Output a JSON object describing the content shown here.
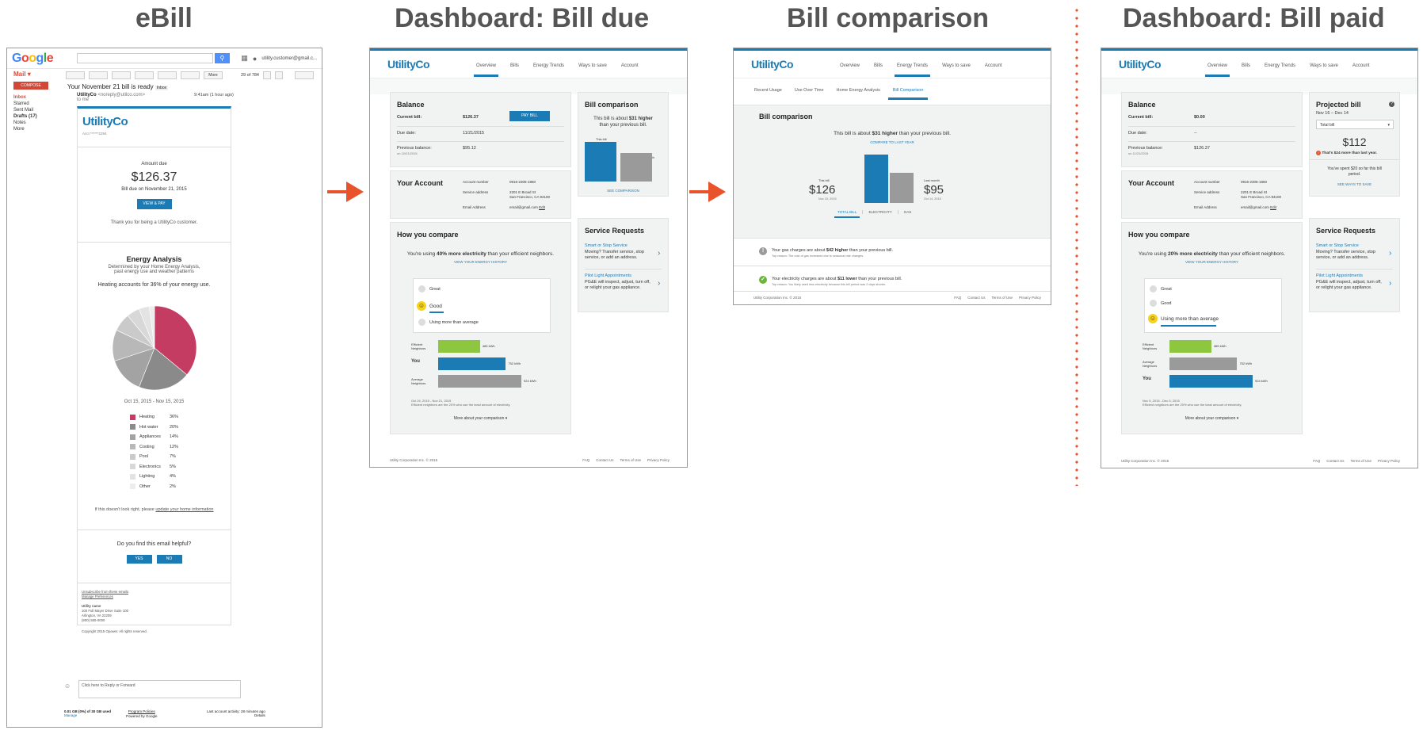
{
  "headings": {
    "ebill": "eBill",
    "bill_due": "Dashboard: Bill due",
    "comparison": "Bill comparison",
    "bill_paid": "Dashboard: Bill paid"
  },
  "colors": {
    "brand": "#1a7bb5",
    "arrow": "#e8532b",
    "heating": "#c53c62",
    "efficient": "#8dc63f",
    "gray_bar": "#9a9a9a"
  },
  "gmail": {
    "logo": "Google",
    "user": "utility.customer@gmail.c...",
    "mail_label": "Mail",
    "compose": "COMPOSE",
    "nav": [
      "Inbox",
      "Starred",
      "Sent Mail",
      "Drafts (17)",
      "Notes",
      "More"
    ],
    "more_btn": "More",
    "count": "29 of 784",
    "subject": "Your November 21 bill is ready",
    "subject_tag": "Inbox",
    "from": "UtilityCo",
    "from_email": "<noreply@utilco.com>",
    "to_me": "to me",
    "time": "9:41am (1 hour ago)",
    "reply_placeholder": "Click here to Reply or Forward",
    "storage": "0.01 GB (0%) of 30 GB used",
    "manage": "Manage",
    "policies": "Program Policies",
    "powered": "Powered by Google",
    "activity": "Last account activity: 28 minutes ago",
    "details": "Details"
  },
  "email": {
    "logo": "UtilityCo",
    "acct": "Acct ******2294",
    "amount_label": "Amount due",
    "amount": "$126.37",
    "due": "Bill due on November 21, 2015",
    "view_pay": "VIEW & PAY",
    "thanks": "Thank you for being a UtilityCo customer.",
    "ea_title": "Energy Analysis",
    "ea_sub": "Determined by your Home Energy Analysis, past energy use and weather patterns",
    "ea_heat": "Heating accounts for 36% of your energy use.",
    "ea_period": "Oct 15, 2015 - Nov 15, 2015",
    "legend": [
      {
        "name": "Heating",
        "pct": "36%",
        "value": 36,
        "color": "#c53c62"
      },
      {
        "name": "Hot water",
        "pct": "20%",
        "value": 20,
        "color": "#8a8a8a"
      },
      {
        "name": "Appliances",
        "pct": "14%",
        "value": 14,
        "color": "#a3a3a3"
      },
      {
        "name": "Cooling",
        "pct": "12%",
        "value": 12,
        "color": "#b8b8b8"
      },
      {
        "name": "Pool",
        "pct": "7%",
        "value": 7,
        "color": "#cacaca"
      },
      {
        "name": "Electronics",
        "pct": "5%",
        "value": 5,
        "color": "#d8d8d8"
      },
      {
        "name": "Lighting",
        "pct": "4%",
        "value": 4,
        "color": "#e3e3e3"
      },
      {
        "name": "Other",
        "pct": "2%",
        "value": 2,
        "color": "#ededed"
      }
    ],
    "not_right": "If this doesn't look right, please",
    "update_link": "update your home information",
    "helpful": "Do you find this email helpful?",
    "yes": "YES",
    "no": "NO",
    "unsub": "Unsubscribe from these emails",
    "prefs": "Manage Preferences",
    "addr_name": "Utility name",
    "addr1": "100 Full Mayer Drive Suite 100",
    "addr2": "Arlington, VA 22209",
    "phone": "(800) 555-0000",
    "copyright": "Copyright 2015 Opower. All rights reserved."
  },
  "dash": {
    "logo": "UtilityCo",
    "nav": [
      "Overview",
      "Bills",
      "Energy Trends",
      "Ways to save",
      "Account"
    ],
    "footer_copy": "Utility Corporation Inc. © 2015",
    "footer_links": [
      "FAQ",
      "Contact Us",
      "Terms of Use",
      "Privacy Policy"
    ]
  },
  "due": {
    "balance_title": "Balance",
    "current_label": "Current bill:",
    "current": "$126.37",
    "pay": "PAY BILL",
    "due_label": "Due date:",
    "due": "11/21/2015",
    "prev_label": "Previous balance:",
    "prev_sub": "on 10/21/2015",
    "prev": "$95.12",
    "acct_title": "Your Account",
    "acct_num_label": "Account number",
    "acct_num": "0916-2305-1860",
    "svc_label": "Service address",
    "svc1": "2201 E Broad St",
    "svc2": "San Francisco, CA 94100",
    "email_label": "Email Address",
    "email": "email@gmail.com",
    "edit": "Edit",
    "hyc_title": "How you compare",
    "hyc_pre": "You're using ",
    "hyc_bold": "40% more electricity",
    "hyc_post": " than your efficient neighbors.",
    "hyc_link": "VIEW YOUR ENERGY HISTORY",
    "ratings": [
      "Great",
      "Good",
      "Using more than average"
    ],
    "neighbors": [
      {
        "label": "Efficient Neighbors",
        "value": 465,
        "text": "465 kWh"
      },
      {
        "label": "You",
        "value": 752,
        "text": "752 kWh"
      },
      {
        "label": "Average Neighbors",
        "value": 924,
        "text": "924 kWh"
      }
    ],
    "period": "Oct 24, 2015 - Nov 21, 2015",
    "period_note": "Efficient neighbors are the 20% who use the least amount of electricity.",
    "more": "More about your comparison",
    "bc_title": "Bill comparison",
    "bc_pre": "This bill is about ",
    "bc_bold": "$31 higher",
    "bc_post": "than your previous bill.",
    "bc_this": "This bill",
    "bc_last": "Last month",
    "bc_link": "SEE COMPARISON",
    "sr_title": "Service Requests",
    "sr1_link": "Smart or Stop Service",
    "sr1_text": "Moving? Transfer service, stop service, or add an address.",
    "sr2_link": "Pilot Light Appointments",
    "sr2_text": "PG&E will inspect, adjust, turn off, or relight your gas appliance."
  },
  "cmp": {
    "subtabs": [
      "Recent Usage",
      "Use Over Time",
      "Home Energy Analysis",
      "Bill Comparison"
    ],
    "title": "Bill comparison",
    "sentence_pre": "This bill is about ",
    "sentence_bold": "$31 higher",
    "sentence_post": " than your previous bill.",
    "compare_link": "COMPARE TO LAST YEAR",
    "this_label": "This bill",
    "this_value": "$126",
    "this_date": "Nov 15, 2015",
    "last_label": "Last month",
    "last_value": "$95",
    "last_date": "Oct 14, 2015",
    "tabs": [
      "TOTAL BILL",
      "ELECTRICITY",
      "GAS"
    ],
    "gas_pre": "Your gas charges are about ",
    "gas_bold": "$42 higher",
    "gas_post": " than your previous bill.",
    "gas_note": "Top reason: The cost of gas increased due to seasonal rate changes.",
    "elec_pre": "Your electricity charges are about ",
    "elec_bold": "$11 lower",
    "elec_post": " than your previous bill.",
    "elec_note": "Top reason: You likely used less electricity because this bill period was 2 days shorter.",
    "footer_copy": "Utility Corporation Inc. © 2015"
  },
  "paid": {
    "current": "$0.00",
    "due": "--",
    "prev": "$126.37",
    "prev_sub": "on 11/21/2015",
    "hyc_bold": "20% more electricity",
    "neighbors": [
      {
        "label": "Efficient Neighbors",
        "value": 465,
        "text": "465 kWh"
      },
      {
        "label": "Average Neighbors",
        "value": 752,
        "text": "752 kWh"
      },
      {
        "label": "You",
        "value": 924,
        "text": "924 kWh"
      }
    ],
    "period": "Nov 5, 2015 - Dec 5, 2015",
    "proj_title": "Projected bill",
    "proj_range": "Nov 16 – Dec 14",
    "proj_select": "Total bill",
    "proj_amount": "$112",
    "proj_warn": "That's $24 more than last year.",
    "proj_spent": "You've spent $20 so far this bill period.",
    "proj_link": "SEE WAYS TO SAVE"
  }
}
